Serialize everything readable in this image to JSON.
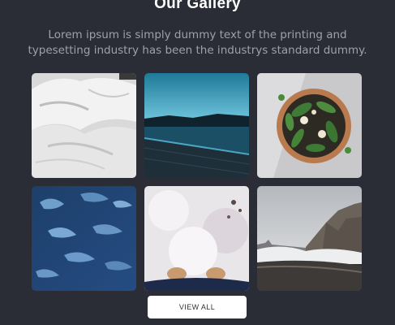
{
  "gallery": {
    "title": "Our Gallery",
    "description": "Lorem ipsum is simply dummy text of the printing and typesetting industry has been the industrys standard dummy.",
    "images": [
      {
        "subject": "white-bedding-photo"
      },
      {
        "subject": "lake-pier-photo"
      },
      {
        "subject": "potted-plant-photo"
      },
      {
        "subject": "water-surface-photo"
      },
      {
        "subject": "snow-feet-photo"
      },
      {
        "subject": "beach-cliff-photo"
      }
    ],
    "view_all_label": "VIEW ALL"
  },
  "colors": {
    "background": "#2a2c36",
    "title": "#ffffff",
    "description": "#9ea0aa",
    "button_bg": "#ffffff",
    "button_text": "#333333"
  }
}
